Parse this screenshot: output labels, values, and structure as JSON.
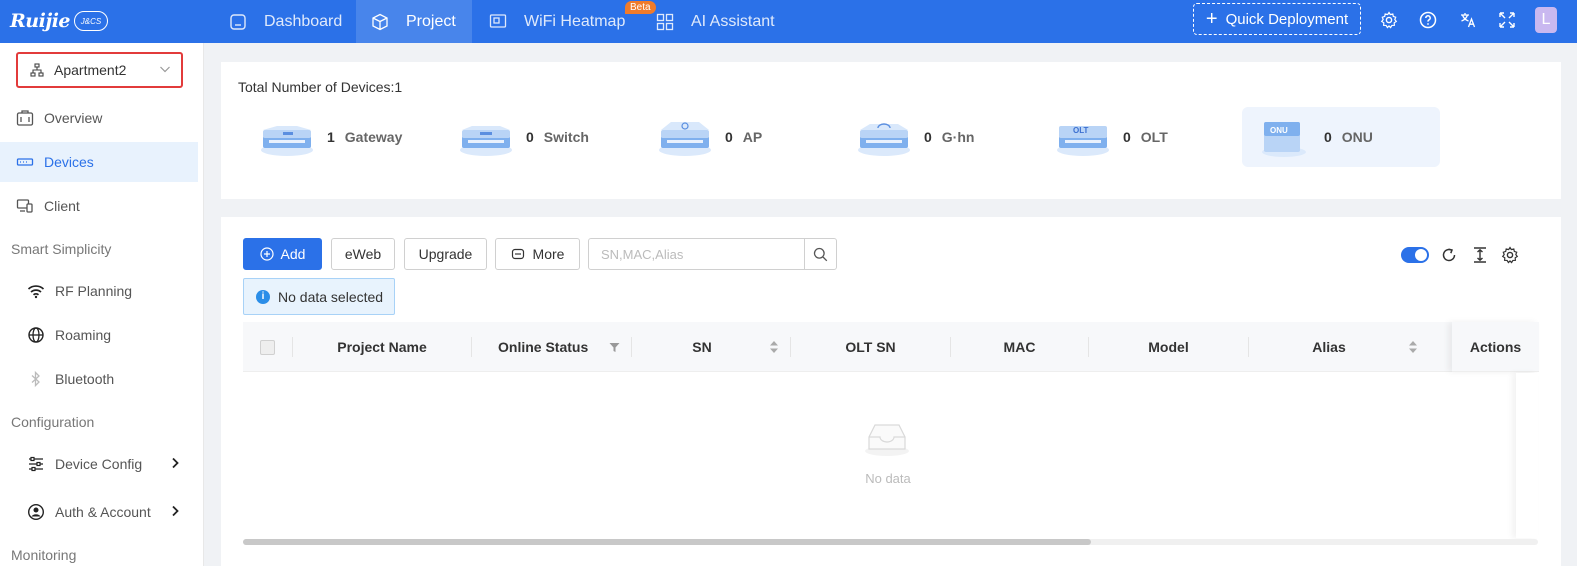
{
  "brand": {
    "logo_text": "Ruijie",
    "logo_badge": "J&CS"
  },
  "nav": {
    "items": [
      {
        "label": "Dashboard",
        "icon": "home-icon",
        "active": false
      },
      {
        "label": "Project",
        "icon": "cube-icon",
        "active": true
      },
      {
        "label": "WiFi Heatmap",
        "icon": "heatmap-icon",
        "active": false
      },
      {
        "label": "AI Assistant",
        "icon": "grid-icon",
        "active": false
      }
    ],
    "beta_badge": "Beta",
    "quick_deployment": "Quick Deployment",
    "avatar_initial": "L"
  },
  "sidebar": {
    "project_selector": "Apartment2",
    "items": [
      {
        "label": "Overview",
        "icon": "overview-icon"
      },
      {
        "label": "Devices",
        "icon": "devices-icon",
        "active": true
      },
      {
        "label": "Client",
        "icon": "client-icon"
      }
    ],
    "groups": {
      "smart": "Smart Simplicity",
      "configuration": "Configuration",
      "monitoring": "Monitoring"
    },
    "smart_items": [
      {
        "label": "RF Planning",
        "icon": "wifi-icon"
      },
      {
        "label": "Roaming",
        "icon": "globe-icon"
      },
      {
        "label": "Bluetooth",
        "icon": "bluetooth-icon"
      }
    ],
    "config_items": [
      {
        "label": "Device Config",
        "icon": "sliders-icon"
      },
      {
        "label": "Auth & Account",
        "icon": "user-circle-icon"
      }
    ]
  },
  "summary": {
    "title": "Total Number of Devices:1",
    "devices": [
      {
        "count": "1",
        "label": "Gateway"
      },
      {
        "count": "0",
        "label": "Switch"
      },
      {
        "count": "0",
        "label": "AP"
      },
      {
        "count": "0",
        "label": "G·hn"
      },
      {
        "count": "0",
        "label": "OLT",
        "badge": "OLT"
      },
      {
        "count": "0",
        "label": "ONU",
        "badge": "ONU"
      }
    ]
  },
  "toolbar": {
    "add": "Add",
    "eweb": "eWeb",
    "upgrade": "Upgrade",
    "more": "More",
    "search_placeholder": "SN,MAC,Alias",
    "selection_info": "No data selected"
  },
  "table": {
    "columns": [
      "Project Name",
      "Online Status",
      "SN",
      "OLT SN",
      "MAC",
      "Model",
      "Alias",
      "Actions"
    ],
    "empty_text": "No data"
  },
  "colors": {
    "primary": "#2b71e8",
    "beta": "#f07b2b",
    "highlight_border": "#e23b3b"
  }
}
